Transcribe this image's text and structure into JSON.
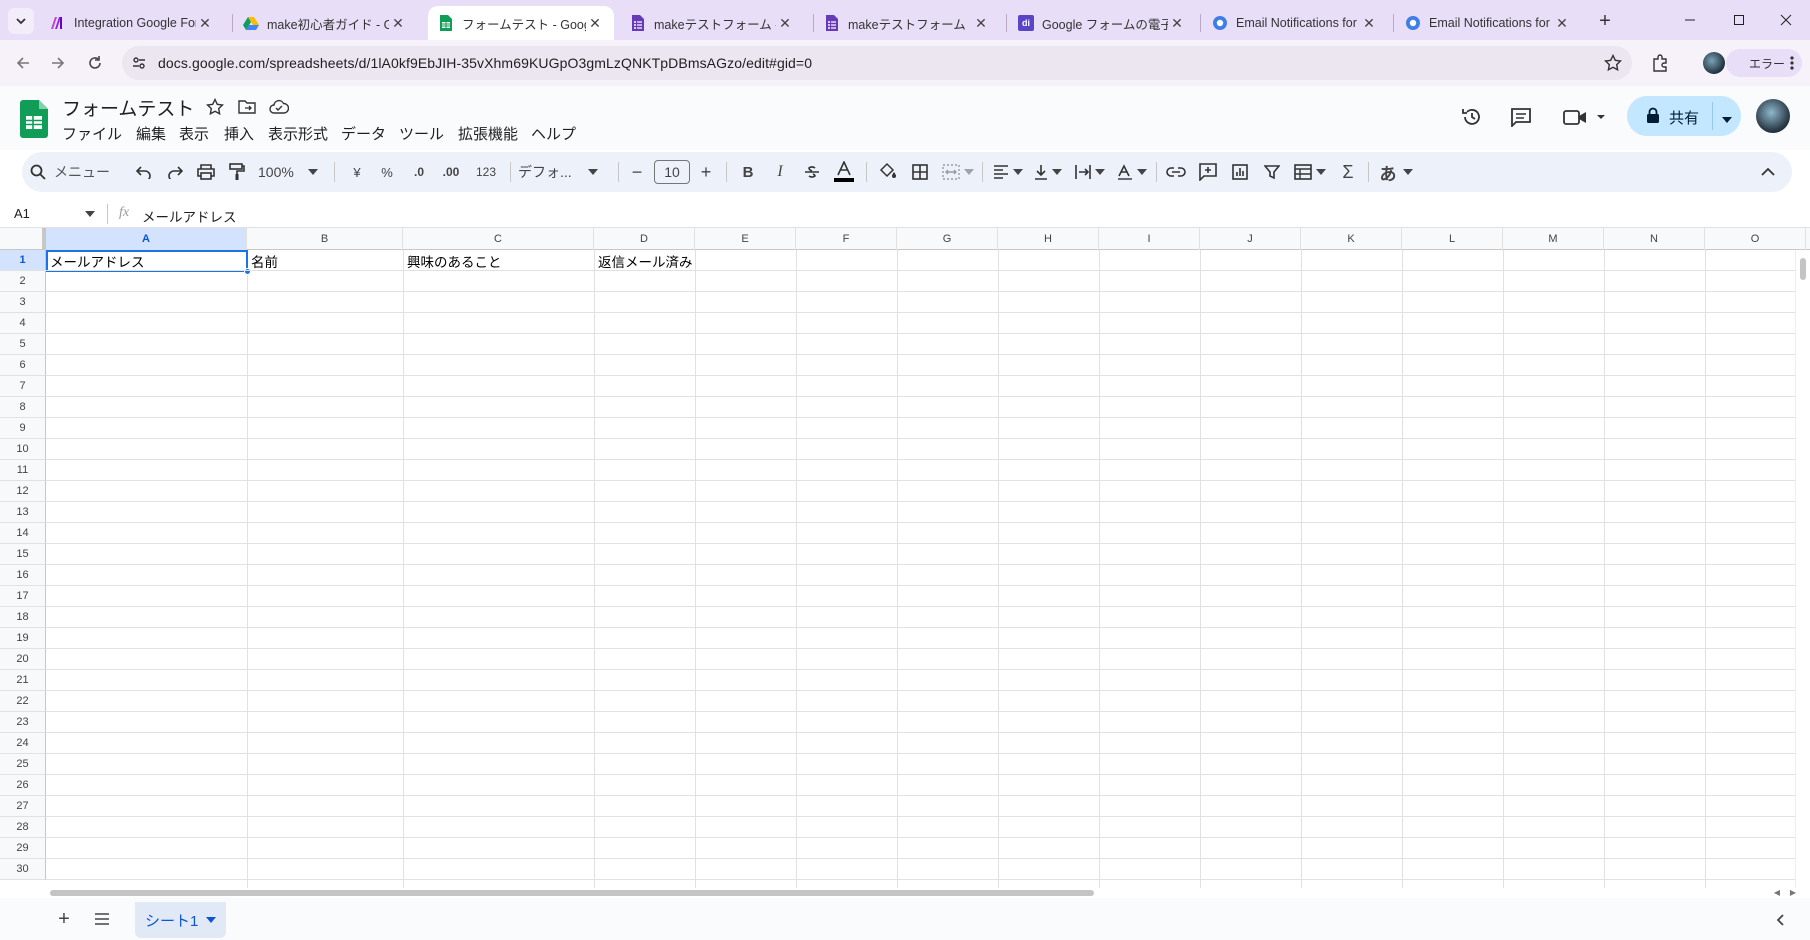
{
  "browser": {
    "tabs": [
      {
        "title": "Integration Google Forms",
        "icon": "make-logo-icon",
        "active": false
      },
      {
        "title": "make初心者ガイド - Google",
        "icon": "google-drive-icon",
        "active": false
      },
      {
        "title": "フォームテスト - Google スプ",
        "icon": "google-sheets-icon",
        "active": true
      },
      {
        "title": "makeテストフォーム - Google",
        "icon": "google-forms-icon",
        "active": false
      },
      {
        "title": "makeテストフォーム",
        "icon": "google-forms-icon",
        "active": false
      },
      {
        "title": "Google フォームの電子メ",
        "icon": "di-site-icon",
        "active": false
      },
      {
        "title": "Email Notifications for",
        "icon": "addon-icon",
        "active": false
      },
      {
        "title": "Email Notifications for",
        "icon": "addon-icon",
        "active": false
      }
    ],
    "url": "docs.google.com/spreadsheets/d/1lA0kf9EbJIH-35vXhm69KUGpO3gmLzQNKTpDBmsAGzo/edit#gid=0",
    "profile_label": "エラー"
  },
  "sheets": {
    "title": "フォームテスト",
    "menu": [
      "ファイル",
      "編集",
      "表示",
      "挿入",
      "表示形式",
      "データ",
      "ツール",
      "拡張機能",
      "ヘルプ"
    ],
    "share_label": "共有",
    "toolbar": {
      "search_label": "メニュー",
      "zoom": "100%",
      "currency": "¥",
      "percent": "%",
      "dec_decrease": ".0",
      "dec_increase": ".00",
      "number_format": "123",
      "font": "デフォ...",
      "font_size": "10",
      "bold": "B",
      "italic": "I",
      "input_tools": "あ"
    },
    "name_box": "A1",
    "formula_value": "メールアドレス",
    "columns": [
      "A",
      "B",
      "C",
      "D",
      "E",
      "F",
      "G",
      "H",
      "I",
      "J",
      "K",
      "L",
      "M",
      "N",
      "O"
    ],
    "rows": [
      "1",
      "2",
      "3",
      "4",
      "5",
      "6",
      "7",
      "8",
      "9",
      "10",
      "11",
      "12",
      "13",
      "14",
      "15",
      "16",
      "17",
      "18",
      "19",
      "20",
      "21",
      "22",
      "23",
      "24",
      "25",
      "26",
      "27",
      "28",
      "29",
      "30"
    ],
    "cells": {
      "A1": "メールアドレス",
      "B1": "名前",
      "C1": "興味のあること",
      "D1": "返信メール済み"
    },
    "sheet_tab": "シート1"
  }
}
